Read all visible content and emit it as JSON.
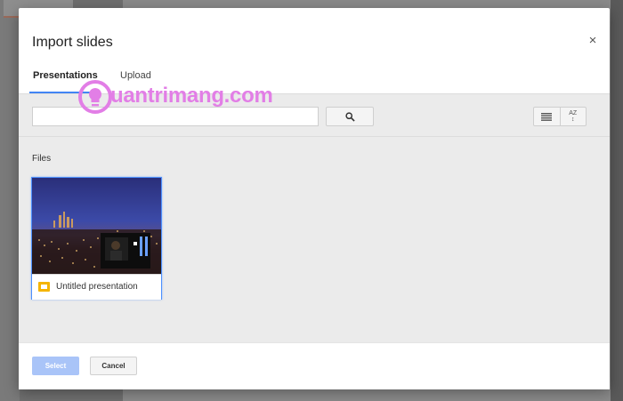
{
  "dialog": {
    "title": "Import slides",
    "close_glyph": "×"
  },
  "tabs": [
    {
      "label": "Presentations",
      "active": true
    },
    {
      "label": "Upload",
      "active": false
    }
  ],
  "search": {
    "value": "",
    "placeholder": "",
    "button_icon": "search-icon"
  },
  "view_controls": {
    "list_icon": "list-view-icon",
    "sort_icon": "sort-az-icon",
    "sort_glyph": "AZ"
  },
  "files": {
    "section_label": "Files",
    "items": [
      {
        "name": "Untitled presentation",
        "type_icon": "slides-icon",
        "selected": true
      }
    ]
  },
  "footer": {
    "select_label": "Select",
    "cancel_label": "Cancel"
  },
  "watermark": {
    "text": "uantrimang.com"
  },
  "colors": {
    "accent": "#4285f4",
    "select_button": "#a9c4f8",
    "slides_icon": "#f4b400",
    "watermark": "#e27ee6",
    "content_bg": "#ebebeb"
  }
}
